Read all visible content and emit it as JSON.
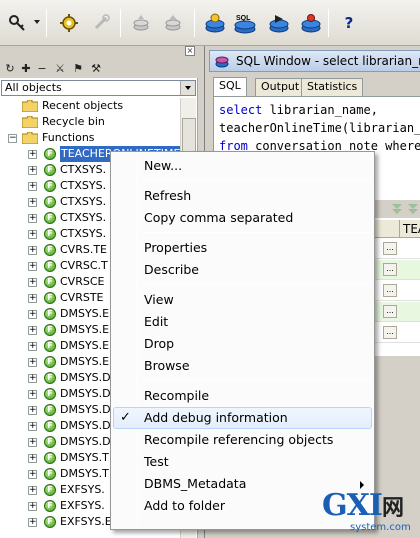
{
  "toolbar": {
    "buttons": [
      {
        "icon": "key-icon"
      },
      {
        "icon": "gear-run-icon"
      },
      {
        "icon": "wrench-icon"
      },
      {
        "icon": "stack-icon"
      },
      {
        "icon": "stack-up-icon"
      },
      {
        "icon": "database-icon"
      },
      {
        "icon": "sql-database-icon"
      },
      {
        "icon": "database-run-icon"
      },
      {
        "icon": "database-edit-icon"
      },
      {
        "icon": "help-icon"
      }
    ],
    "sql_badge": "SQL",
    "help_label": "?"
  },
  "object_browser": {
    "filter_value": "All objects",
    "close_glyph": "×",
    "tools": [
      "↻",
      "✚",
      "−",
      "⚔",
      "⚑",
      "⚒"
    ],
    "folders": [
      {
        "label": "Recent objects",
        "expanded": false
      },
      {
        "label": "Recycle bin",
        "expanded": false
      },
      {
        "label": "Functions",
        "expanded": true
      }
    ],
    "functions": [
      "TEACHERONLINETIME",
      "CTXSYS.",
      "CTXSYS.",
      "CTXSYS.",
      "CTXSYS.",
      "CTXSYS.",
      "CVRS.TE",
      "CVRSC.T",
      "CVRSCE",
      "CVRSTE",
      "DMSYS.E",
      "DMSYS.E",
      "DMSYS.E",
      "DMSYS.E",
      "DMSYS.D",
      "DMSYS.D",
      "DMSYS.D",
      "DMSYS.D",
      "DMSYS.D",
      "DMSYS.T",
      "DMSYS.T",
      "EXFSYS.",
      "EXFSYS.",
      "EXFSYS.EVALUATE_S"
    ],
    "function_icon_glyph": "F"
  },
  "sql_window": {
    "title": "SQL Window - select librarian_name, teacherOnlineTime",
    "tabs": [
      "SQL",
      "Output",
      "Statistics"
    ],
    "code": [
      {
        "kw": "select",
        "rest": " librarian_name,"
      },
      {
        "kw": "",
        "rest": "teacherOnlineTime(librarian_name)"
      },
      {
        "kw": "from",
        "rest": " conversation_note where"
      }
    ],
    "grid_column": "TEA",
    "cell_button": "..."
  },
  "context_menu": {
    "items": [
      {
        "label": "New...",
        "checked": false
      },
      {
        "label": "Refresh",
        "checked": false
      },
      {
        "label": "Copy comma separated",
        "checked": false
      },
      {
        "label": "Properties",
        "checked": false
      },
      {
        "label": "Describe",
        "checked": false
      },
      {
        "label": "View",
        "checked": false
      },
      {
        "label": "Edit",
        "checked": false
      },
      {
        "label": "Drop",
        "checked": false
      },
      {
        "label": "Browse",
        "checked": false
      },
      {
        "label": "Recompile",
        "checked": false
      },
      {
        "label": "Add debug information",
        "checked": true,
        "highlighted": true
      },
      {
        "label": "Recompile referencing objects",
        "checked": false
      },
      {
        "label": "Test",
        "checked": false
      },
      {
        "label": "DBMS_Metadata",
        "checked": false,
        "submenu": true
      },
      {
        "label": "Add to folder",
        "checked": false
      }
    ],
    "check_glyph": "✓"
  },
  "watermark": {
    "main": "GXI",
    "net": "网",
    "sub": "system.com"
  }
}
